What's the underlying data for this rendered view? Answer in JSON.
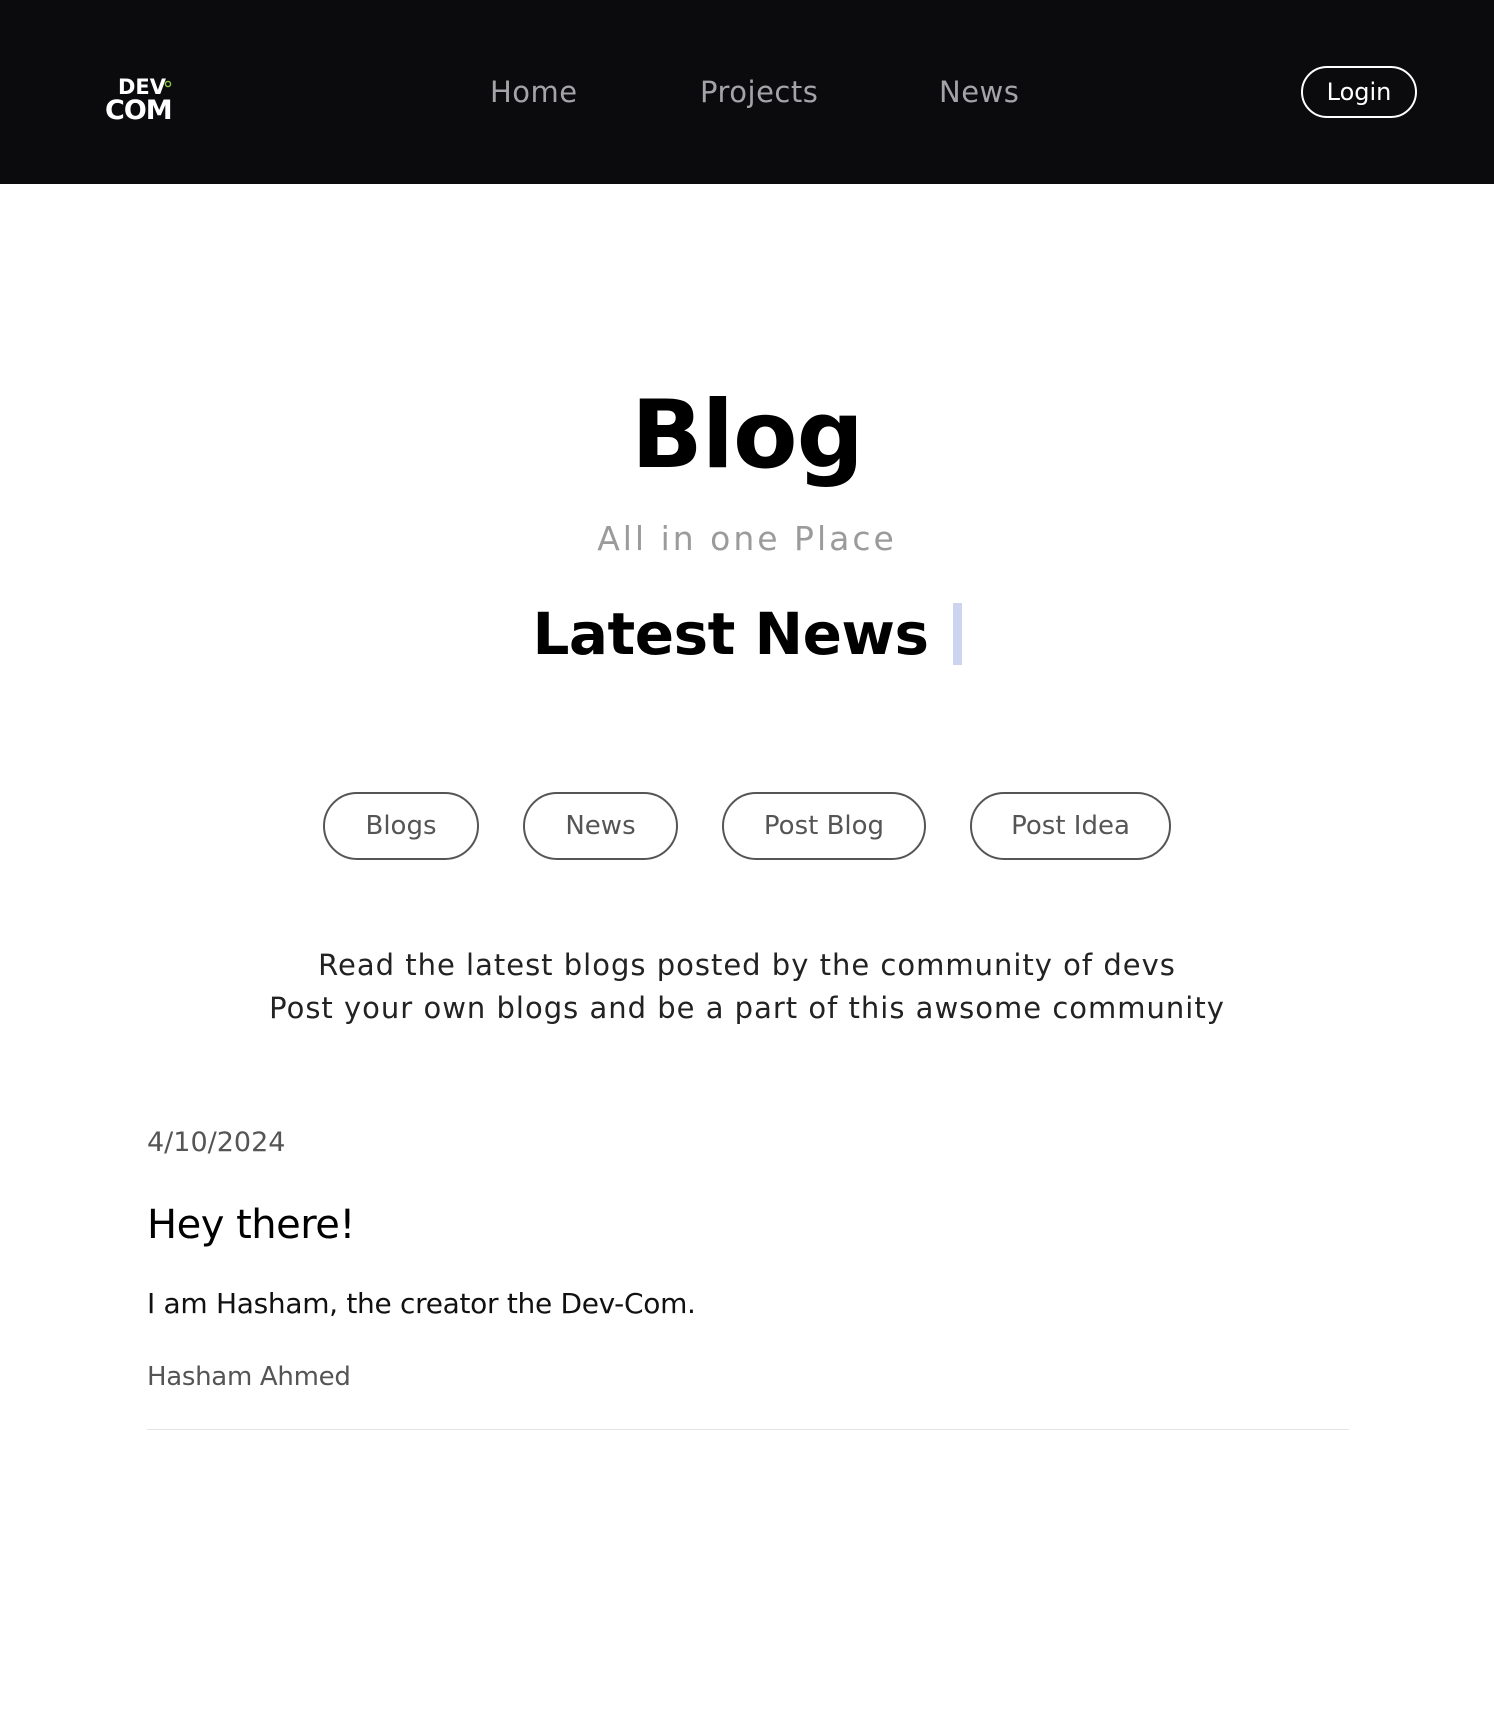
{
  "brand": {
    "logo_top": "DEV",
    "logo_bottom": "COM",
    "accent_dot_color": "#8bc34a"
  },
  "nav": {
    "links": [
      "Home",
      "Projects",
      "News"
    ],
    "login_label": "Login"
  },
  "hero": {
    "title": "Blog",
    "subtitle": "All in one Place",
    "typing_text": "Latest News"
  },
  "tabs": [
    "Blogs",
    "News",
    "Post Blog",
    "Post Idea"
  ],
  "intro": {
    "line1": "Read the latest blogs posted by the community of devs",
    "line2": "Post your own blogs and be a part of this awsome community"
  },
  "posts": [
    {
      "date": "4/10/2024",
      "title": "Hey there!",
      "body": "I am Hasham, the creator the Dev-Com.",
      "author": "Hasham Ahmed"
    }
  ],
  "colors": {
    "navbar_bg": "#0b0b0d",
    "cursor": "#ccd4ef"
  }
}
